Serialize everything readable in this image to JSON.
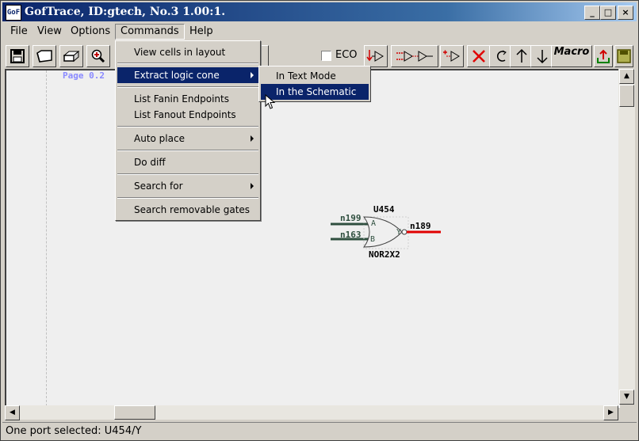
{
  "window": {
    "title": "GofTrace, ID:gtech, No.3 1.00:1.",
    "icon_text": "GoF",
    "controls": {
      "minimize": "_",
      "maximize": "□",
      "close": "×"
    }
  },
  "menubar": {
    "items": [
      "File",
      "View",
      "Options",
      "Commands",
      "Help"
    ]
  },
  "toolbar": {
    "eco_label": "ECO",
    "eco_checked": false,
    "macro_label": "Macro"
  },
  "commands_menu": {
    "items": [
      {
        "label": "View cells in layout"
      },
      {
        "label": "Extract logic cone",
        "has_submenu": true,
        "highlighted": true
      },
      {
        "label": "List Fanin Endpoints"
      },
      {
        "label": "List Fanout Endpoints"
      },
      {
        "label": "Auto place",
        "has_submenu": true
      },
      {
        "label": "Do diff"
      },
      {
        "label": "Search for",
        "has_submenu": true
      },
      {
        "label": "Search removable gates"
      }
    ]
  },
  "submenu": {
    "items": [
      {
        "label": "In Text Mode"
      },
      {
        "label": "In the Schematic",
        "highlighted": true
      }
    ]
  },
  "canvas": {
    "page_label": "Page 0.2",
    "gate": {
      "instance": "U454",
      "cell": "NOR2X2",
      "pin_a": "A",
      "pin_b": "B",
      "pin_y": "Y",
      "input_nets": [
        "n199",
        "n163"
      ],
      "output_net": "n189",
      "output_color": "#e00000",
      "input_color": "#2f4f3f"
    }
  },
  "status": {
    "text": "One port selected: U454/Y"
  },
  "colors": {
    "titlebar": "#0a246a",
    "highlight": "#0a246a",
    "selected_net": "#e00000"
  }
}
